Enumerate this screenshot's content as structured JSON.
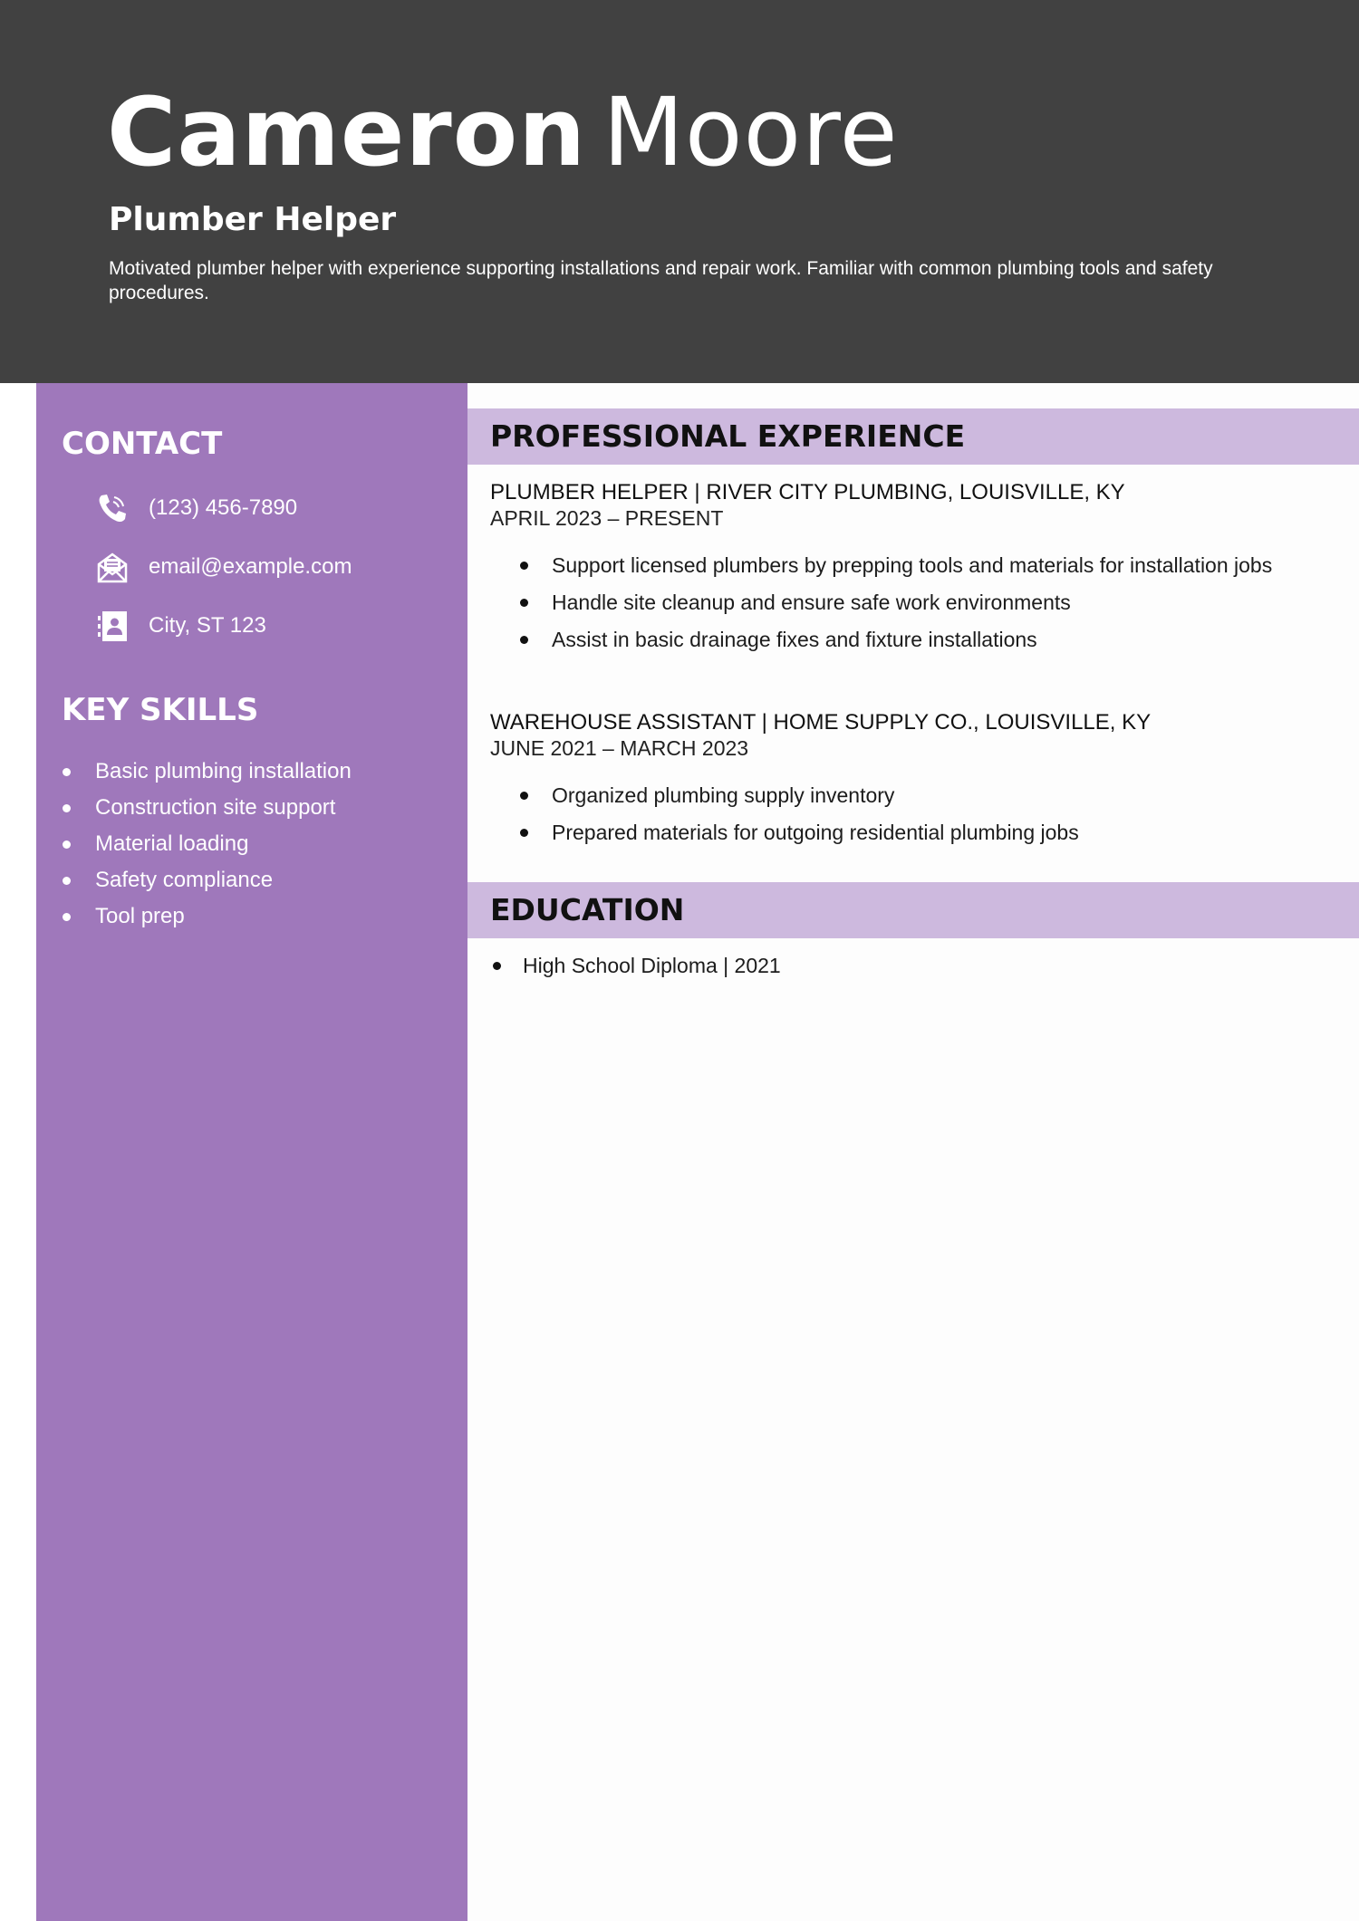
{
  "header": {
    "first_name": "Cameron",
    "last_name": "Moore",
    "title": "Plumber Helper",
    "summary": "Motivated plumber helper with experience supporting installations and repair work. Familiar with common plumbing tools and safety procedures."
  },
  "sidebar": {
    "contact_heading": "CONTACT",
    "contact": [
      {
        "icon": "phone-icon",
        "text": "(123) 456-7890"
      },
      {
        "icon": "email-icon",
        "text": "email@example.com"
      },
      {
        "icon": "address-icon",
        "text": "City, ST 123"
      }
    ],
    "skills_heading": "KEY SKILLS",
    "skills": [
      "Basic plumbing installation",
      "Construction site support",
      "Material loading",
      "Safety compliance",
      "Tool prep"
    ]
  },
  "experience": {
    "heading": "PROFESSIONAL EXPERIENCE",
    "jobs": [
      {
        "title": "PLUMBER HELPER",
        "company": "RIVER CITY PLUMBING, LOUISVILLE, KY",
        "dates": "APRIL 2023 – PRESENT",
        "bullets": [
          "Support licensed plumbers by prepping tools and materials for installation jobs",
          "Handle site cleanup and ensure safe work environments",
          "Assist in basic drainage fixes and fixture installations"
        ]
      },
      {
        "title": "WAREHOUSE ASSISTANT",
        "company": "HOME SUPPLY CO., LOUISVILLE, KY",
        "dates": "JUNE 2021 – MARCH 2023",
        "bullets": [
          "Organized plumbing supply inventory",
          "Prepared materials for outgoing residential plumbing jobs"
        ]
      }
    ]
  },
  "education": {
    "heading": "EDUCATION",
    "items": [
      "High School Diploma | 2021"
    ]
  },
  "colors": {
    "header_bg": "#414141",
    "sidebar_bg": "#9f78bb",
    "section_bar_bg": "#cdb9de"
  }
}
